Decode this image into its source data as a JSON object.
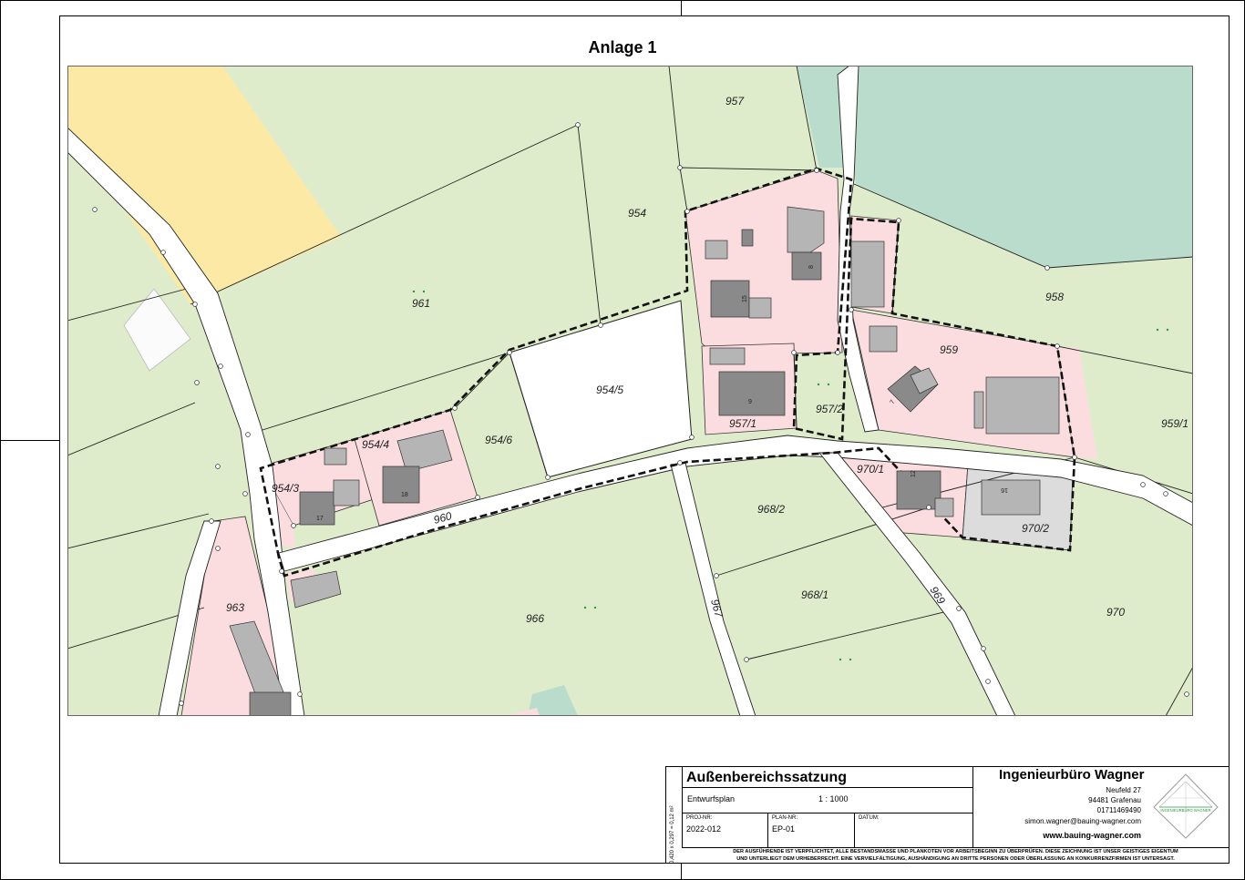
{
  "title": "Anlage 1",
  "map": {
    "parcels": [
      "957",
      "954",
      "961",
      "958",
      "959",
      "954/5",
      "954/4",
      "954/3",
      "954/6",
      "957/1",
      "957/2",
      "959/1",
      "970/1",
      "970/2",
      "968/2",
      "968/1",
      "966",
      "963",
      "970"
    ],
    "roads": [
      "960",
      "967",
      "969"
    ],
    "house_numbers": [
      "8",
      "15",
      "9",
      "7",
      "17",
      "18",
      "12",
      "16"
    ]
  },
  "titleblock": {
    "project_title": "Außenbereichssatzung",
    "plan_type": "Entwurfsplan",
    "scale": "1 : 1000",
    "proj_nr_label": "PROJ-NR:",
    "proj_nr": "2022-012",
    "plan_nr_label": "PLAN-NR:",
    "plan_nr": "EP-01",
    "datum_label": "DATUM:",
    "format": "0,420 x 0,297 = 0,12 m²",
    "company": "Ingenieurbüro Wagner",
    "street": "Neufeld 27",
    "city": "94481 Grafenau",
    "phone": "01711469490",
    "email": "simon.wagner@bauing-wagner.com",
    "web": "www.bauing-wagner.com",
    "logo_text": "INGENIEURBÜRO WAGNER",
    "disclaimer_1": "DER AUSFÜHRENDE IST VERPFLICHTET, ALLE BESTANDSMASSE UND PLANKOTEN VOR ARBEITSBEGINN ZU ÜBERPRÜFEN. DIESE ZEICHNUNG IST UNSER GEISTIGES EIGENTUM",
    "disclaimer_2": "UND UNTERLIEGT DEM URHEBERRECHT. EINE VERVIELFÄLTIGUNG, AUSHÄNDIGUNG AN DRITTE PERSONEN ODER ÜBERLASSUNG AN KONKURRENZFIRMEN IST UNTERSAGT."
  }
}
